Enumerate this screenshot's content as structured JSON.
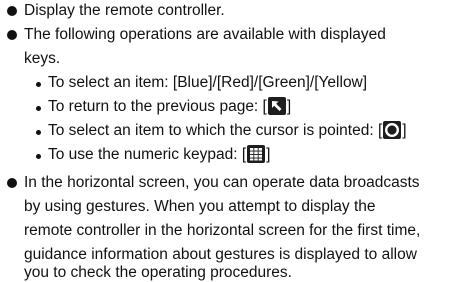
{
  "items": [
    {
      "text": "Display the remote controller."
    },
    {
      "line1": "The following operations are available with displayed",
      "line2": "keys."
    },
    {
      "text": "In the horizontal screen, you can operate data broadcasts"
    }
  ],
  "sub_items": [
    {
      "text": "To select an item: [Blue]/[Red]/[Green]/[Yellow]"
    },
    {
      "prefix": "To return to the previous page: [",
      "suffix": "]",
      "icon": "back-arrow-icon"
    },
    {
      "prefix": "To select an item to which the cursor is pointed: [",
      "suffix": "]",
      "icon": "ok-circle-icon"
    },
    {
      "prefix": "To use the numeric keypad: [",
      "suffix": "]",
      "icon": "numeric-keypad-icon"
    }
  ],
  "paragraph_continuation": [
    "by using gestures. When you attempt to display the",
    "remote controller in the horizontal screen for the first time,",
    "guidance information about gestures is displayed to allow",
    "you to check the operating procedures."
  ]
}
